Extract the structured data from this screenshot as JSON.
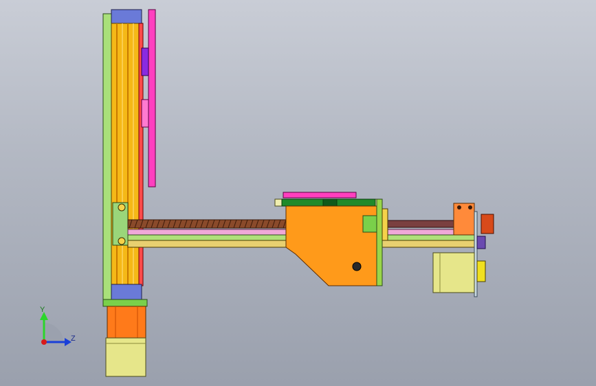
{
  "triad": {
    "y_label": "Y",
    "z_label": "Z",
    "colors": {
      "y": "#2bd62b",
      "z": "#1a3fd8",
      "x": "#d81a1a"
    }
  },
  "colors": {
    "rail_green": "#a9e07a",
    "extrusion_yellow": "#f5b817",
    "carriage_orange": "#ff9a1a",
    "plate_magenta": "#ff3fbf",
    "motor_yellow": "#e6e68a",
    "leadscrew_brown": "#8a4a2a"
  }
}
